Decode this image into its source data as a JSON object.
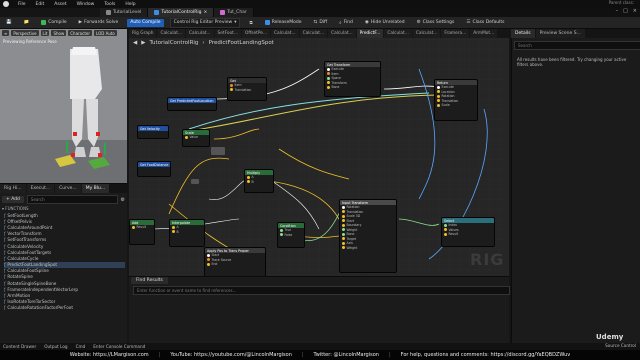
{
  "menu": [
    "File",
    "Edit",
    "Asset",
    "Window",
    "Tools",
    "Help"
  ],
  "file_tabs": [
    {
      "label": "TutorialLevel",
      "active": false
    },
    {
      "label": "TutorialControlRig",
      "active": true
    },
    {
      "label": "Tut_Char",
      "active": false
    }
  ],
  "parent_class": "Parent class: ",
  "toolbar": {
    "compile": "Compile",
    "forwards_solve": "Forwards Solve",
    "auto_compile": "Auto Compile",
    "preview": "Control Rig Editor Preview",
    "release_mode": "ReleaseMode",
    "diff": "Diff",
    "find": "Find",
    "hide_unrelated": "Hide Unrelated",
    "class_settings": "Class Settings",
    "class_defaults": "Class Defaults"
  },
  "viewport": {
    "chips": [
      "Perspective",
      "Lit",
      "Show",
      "Character",
      "LOD Auto"
    ],
    "title": "Previewing Reference Pose"
  },
  "left_panel": {
    "tabs": [
      "Rig Hi...",
      "Execut...",
      "Curve...",
      "My Blu..."
    ],
    "add": "+ Add",
    "search_placeholder": "Search",
    "functions_header": "FUNCTIONS",
    "functions": [
      "SetFootLength",
      "OffsetPelvis",
      "CalculateAroundPoint",
      "VectorTransform",
      "SetFootTransforms",
      "CalculateVelocity",
      "CalculateFootTargets",
      "CalculateCycle",
      "PredictFootLandingSpot",
      "CalculateFootSpline",
      "RotateSpine",
      "RotateSingleSpineBone",
      "FramerateIndependentVectorLerp",
      "ArmMotion",
      "IsoRotateToreTorSector",
      "CalculateRotationFactorPerFoot"
    ]
  },
  "graph": {
    "tabs": [
      "Rig Graph",
      "Calculat...",
      "Calculat...",
      "SetFoot...",
      "OffsetPe...",
      "Calculat...",
      "Calculat...",
      "Calculat...",
      "PredictF...",
      "Calculat...",
      "Calculat...",
      "Framera...",
      "ArmMot..."
    ],
    "breadcrumb": [
      "TutorialControlRig",
      "PredictFootLandingSpot"
    ],
    "watermark": "RIG"
  },
  "find_results": {
    "tab": "Find Results",
    "placeholder": "Enter function or event name to find references..."
  },
  "details": {
    "tabs": [
      "Details",
      "Preview Scene S..."
    ],
    "search_placeholder": "Search",
    "message": "All results have been filtered. Try changing your active filters above."
  },
  "status": {
    "items": [
      "Content Drawer",
      "Output Log",
      "Cmd",
      "Enter Console Command"
    ],
    "source": "Source Control"
  },
  "footer": {
    "website": "Website: https://LMargison.com",
    "youtube": "YouTube: https://youtube.com/@LincolnMargison",
    "twitter": "Twitter: @LincolnMargison",
    "help": "For help, questions and comments: https://discord.gg/YaEQBDZWuv"
  },
  "watermark_brand": "Udemy",
  "colors": {
    "accent_blue": "#1f5fb8",
    "exec_pin": "#ffffff",
    "vector_pin": "#f2c02a",
    "float_pin": "#8fe08f",
    "transform_pin": "#f08a2a"
  }
}
